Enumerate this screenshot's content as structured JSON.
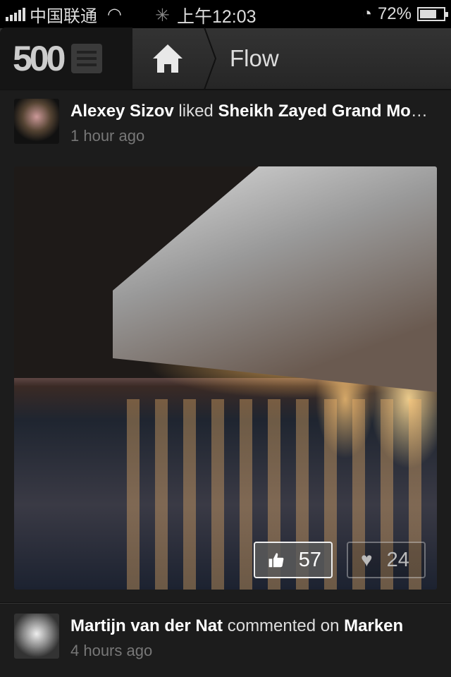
{
  "status": {
    "carrier": "中国联通",
    "time": "上午12:03",
    "battery": "72%",
    "battery_level": 0.72
  },
  "nav": {
    "logo": "500",
    "title": "Flow"
  },
  "feed": [
    {
      "user": "Alexey Sizov",
      "action": "liked",
      "target": "Sheikh Zayed Grand Mosque",
      "time": "1 hour ago",
      "likes": "57",
      "favorites": "24"
    },
    {
      "user": "Martijn van der Nat",
      "action": "commented on",
      "target": "Marken",
      "time": "4 hours ago"
    }
  ],
  "colors": {
    "background": "#1c1c1c",
    "nav": "#2e2e2e"
  }
}
